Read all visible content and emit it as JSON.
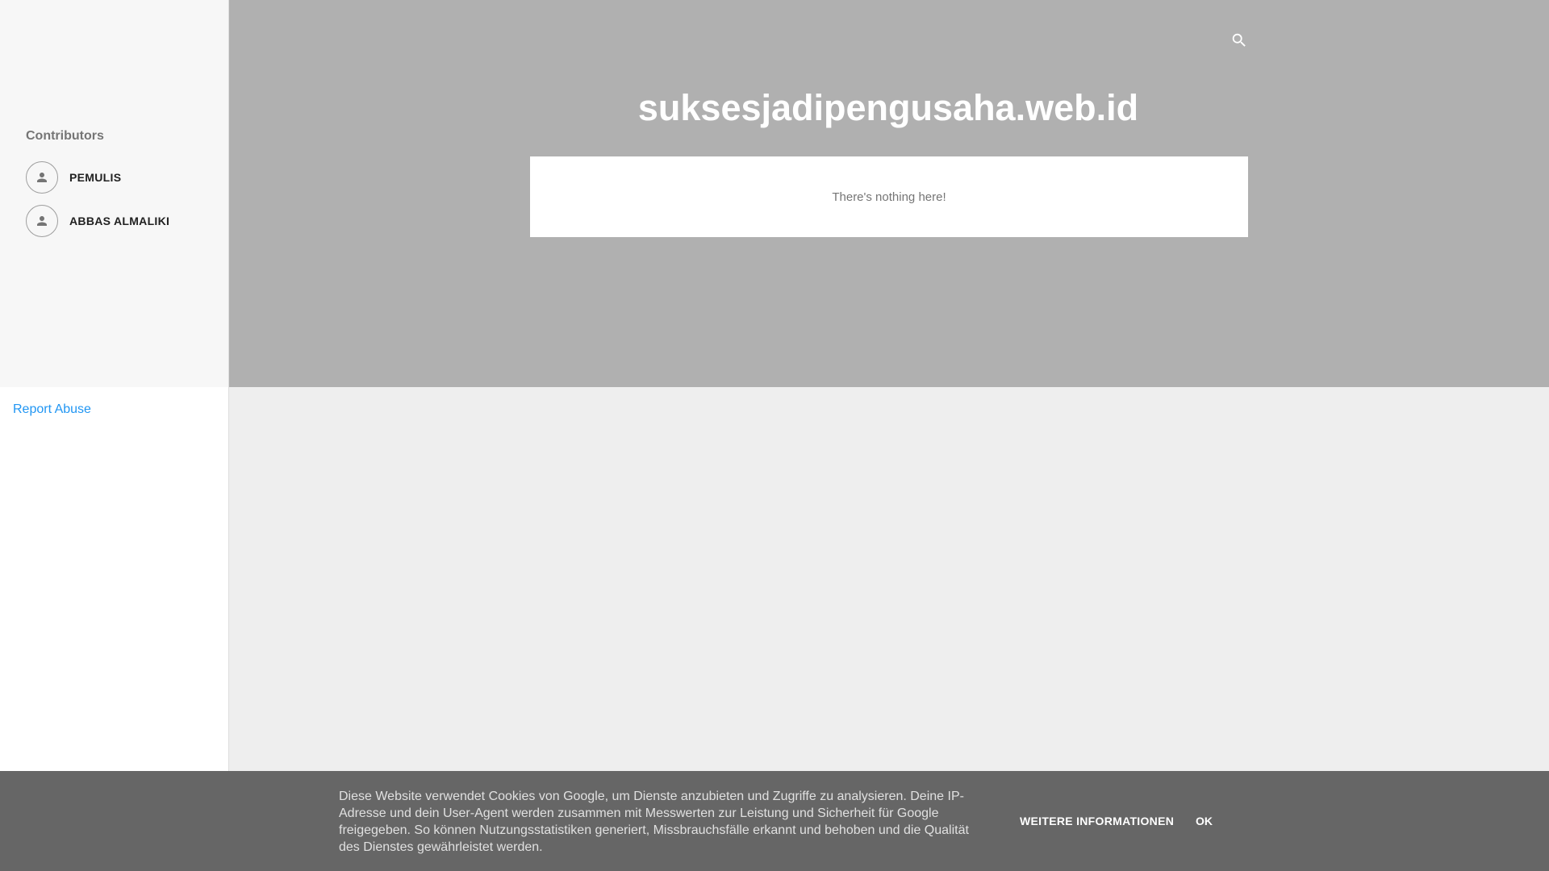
{
  "sidebar": {
    "contributors_title": "Contributors",
    "contributors": [
      {
        "name": "PEMULIS",
        "icon": "person-icon"
      },
      {
        "name": "ABBAS ALMALIKI",
        "icon": "person-icon"
      }
    ],
    "report_abuse": "Report Abuse"
  },
  "header": {
    "site_title": "suksesjadipengusaha.web.id",
    "search_icon": "search-icon"
  },
  "main": {
    "empty_message": "There's nothing here!"
  },
  "cookie_bar": {
    "text": "Diese Website verwendet Cookies von Google, um Dienste anzubieten und Zugriffe zu analysieren. Deine IP-Adresse und dein User-Agent werden zusammen mit Messwerten zur Leistung und Sicherheit für Google freigegeben. So können Nutzungsstatistiken generiert, Missbrauchsfälle erkannt und behoben und die Qualität des Dienstes gewährleistet werden.",
    "more_info_label": "WEITERE INFORMATIONEN",
    "ok_label": "OK"
  },
  "colors": {
    "header_bg": "#b0b0b0",
    "page_bg": "#eeeeee",
    "sidebar_top_bg": "#f7f7f7",
    "link": "#2196f3",
    "cookie_bg": "#666666"
  }
}
